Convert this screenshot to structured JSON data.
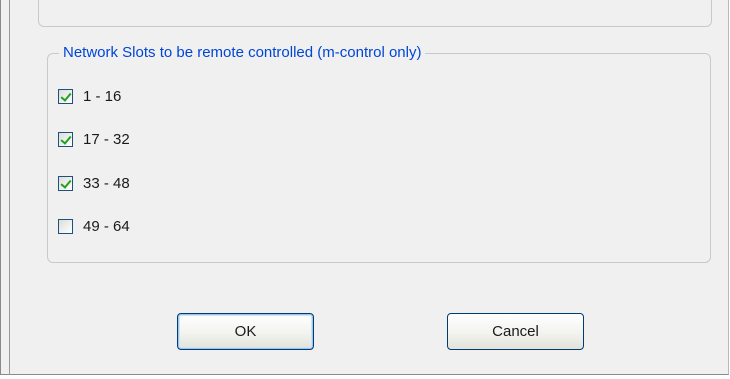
{
  "network_group": {
    "legend": "Network Slots to be remote controlled (m-control only)",
    "slots": [
      {
        "label": "1 - 16",
        "checked": true
      },
      {
        "label": "17 - 32",
        "checked": true
      },
      {
        "label": "33 - 48",
        "checked": true
      },
      {
        "label": "49 - 64",
        "checked": false
      }
    ]
  },
  "buttons": {
    "ok_label": "OK",
    "cancel_label": "Cancel"
  },
  "colors": {
    "legend_text": "#0046d5",
    "check_mark": "#21a121",
    "dialog_background": "#f0f0f0"
  }
}
